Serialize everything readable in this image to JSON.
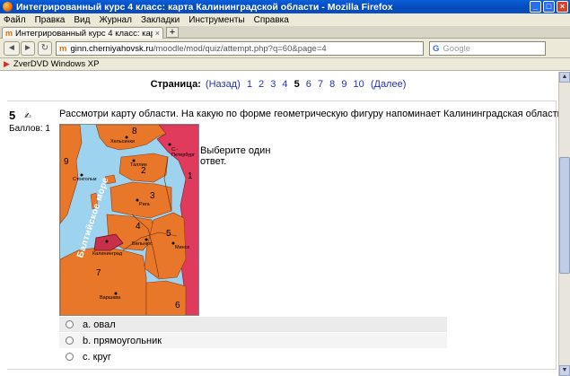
{
  "window": {
    "title": "Интегрированный курс 4 класс: карта Калининградской области - Mozilla Firefox",
    "btn_min": "_",
    "btn_max": "□",
    "btn_close": "×"
  },
  "menu": [
    "Файл",
    "Правка",
    "Вид",
    "Журнал",
    "Закладки",
    "Инструменты",
    "Справка"
  ],
  "tab": {
    "logo": "m",
    "label": "Интегрированный курс 4 класс: карта ...",
    "close": "×",
    "new": "+"
  },
  "nav": {
    "back": "◄",
    "forward": "►",
    "reload": "↻",
    "logo": "m",
    "url_host": "ginn.cherniyahovsk.ru",
    "url_path": "/moodle/mod/quiz/attempt.php?q=60&page=4",
    "star": "☆",
    "dropdown": "▾",
    "search_logo": "G",
    "search_placeholder": "Google"
  },
  "bookmarks": {
    "icon": "▶",
    "item": "ZverDVD Windows XP"
  },
  "scroll": {
    "up": "▲",
    "down": "▼"
  },
  "pages": {
    "label": "Страница:",
    "prev": "(Назад)",
    "items": [
      "1",
      "2",
      "3",
      "4",
      "5",
      "6",
      "7",
      "8",
      "9",
      "10"
    ],
    "current": "5",
    "next": "(Далее)"
  },
  "question": {
    "number": "5",
    "flag": "✍",
    "score": "Баллов: 1",
    "text": "Рассмотри карту области. На какую по форме геометрическую фигуру напоминает Калининградская область?",
    "choose_line1": "Выберите один",
    "choose_line2": "ответ."
  },
  "map": {
    "sea_label": "Балтийское море",
    "cities": [
      "Хельсинки",
      "С.-Петербург",
      "Таллин",
      "Стокгольм",
      "Рига",
      "Вильнюс",
      "Минск",
      "Калининград",
      "Варшава"
    ],
    "numbers": [
      "1",
      "2",
      "3",
      "4",
      "5",
      "6",
      "7",
      "8",
      "9"
    ]
  },
  "options": [
    {
      "letter": "a.",
      "text": "овал"
    },
    {
      "letter": "b.",
      "text": "прямоугольник"
    },
    {
      "letter": "c.",
      "text": "круг"
    }
  ]
}
